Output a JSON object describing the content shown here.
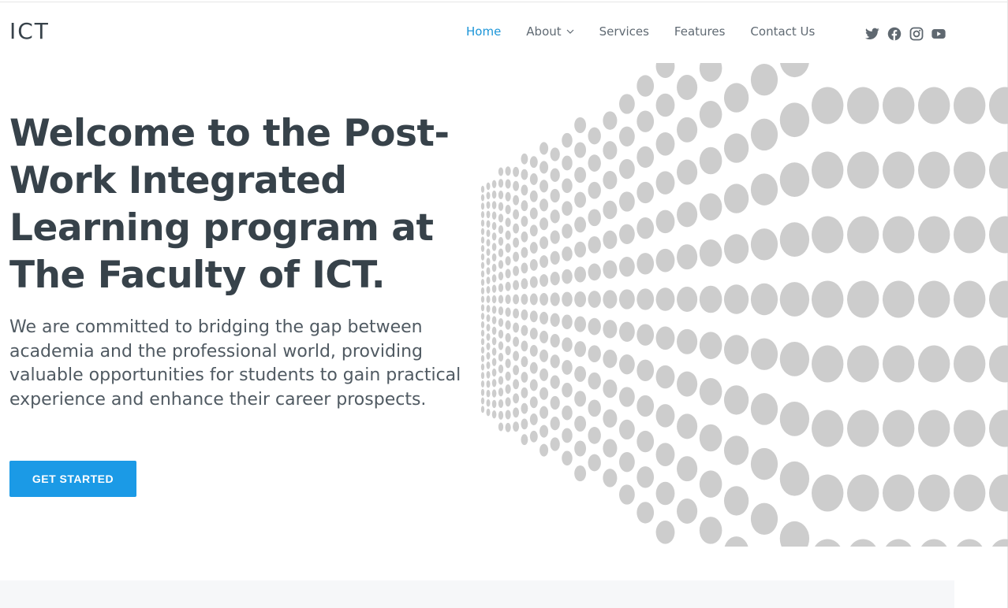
{
  "brand": {
    "logo_text": "ICT",
    "accent_color": "#1b95d8",
    "button_color": "#1b9ae6",
    "text_color": "#37424a"
  },
  "nav": {
    "items": [
      {
        "label": "Home",
        "active": true
      },
      {
        "label": "About",
        "has_dropdown": true
      },
      {
        "label": "Services"
      },
      {
        "label": "Features"
      },
      {
        "label": "Contact Us"
      }
    ]
  },
  "social": {
    "icons": [
      "twitter-icon",
      "facebook-icon",
      "instagram-icon",
      "youtube-icon"
    ]
  },
  "hero": {
    "title": "Welcome to the Post-Work Integrated Learning program at The Faculty of ICT.",
    "description": "We are committed to bridging the gap between academia and the professional world, providing valuable opportunities for students to gain practical experience and enhance their career prospects.",
    "cta_label": "GET STARTED",
    "art": "dot-pattern"
  }
}
